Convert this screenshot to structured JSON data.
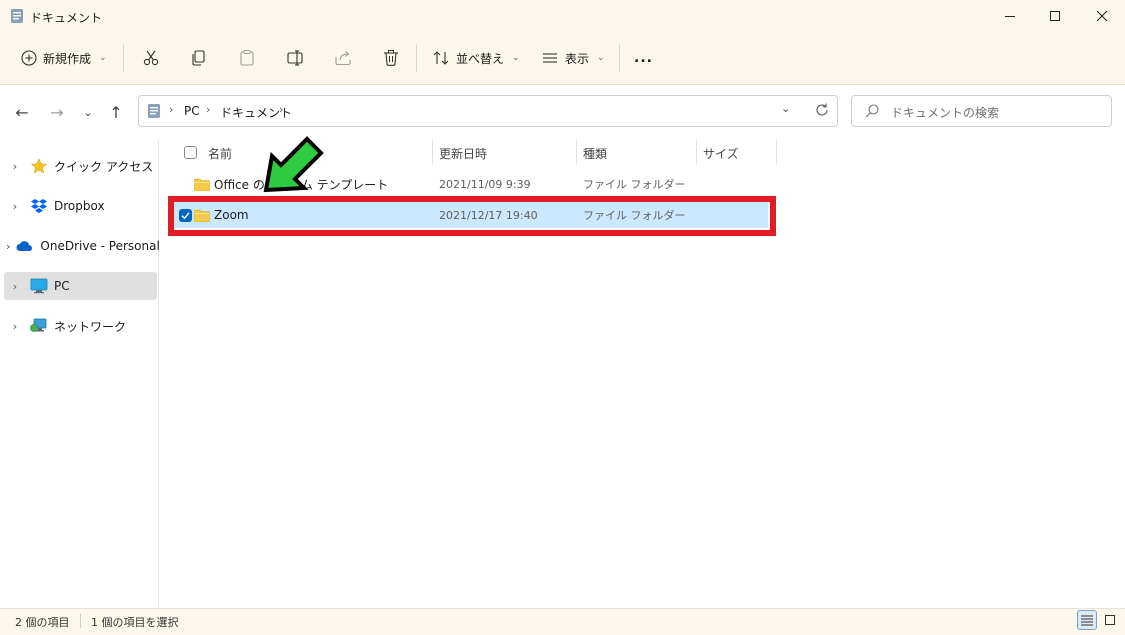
{
  "window": {
    "title": "ドキュメント",
    "icons": {
      "app": "document-icon",
      "minimize": "minimize-icon",
      "maximize": "maximize-icon",
      "close": "close-icon"
    }
  },
  "toolbar": {
    "new_label": "新規作成",
    "sort_label": "並べ替え",
    "view_label": "表示",
    "more_label": "..."
  },
  "address": {
    "crumbs": [
      "PC",
      "ドキュメント"
    ]
  },
  "search": {
    "placeholder": "ドキュメントの検索"
  },
  "sidebar": {
    "items": [
      {
        "label": "クイック アクセス",
        "icon": "star-icon"
      },
      {
        "label": "Dropbox",
        "icon": "dropbox-icon"
      },
      {
        "label": "OneDrive - Personal",
        "icon": "cloud-icon"
      },
      {
        "label": "PC",
        "icon": "monitor-icon",
        "selected": true
      },
      {
        "label": "ネットワーク",
        "icon": "network-icon"
      }
    ]
  },
  "columns": {
    "name": "名前",
    "modified": "更新日時",
    "type": "種類",
    "size": "サイズ"
  },
  "files": [
    {
      "name": "Office のカスタム テンプレート",
      "modified": "2021/11/09 9:39",
      "type": "ファイル フォルダー",
      "selected": false
    },
    {
      "name": "Zoom",
      "modified": "2021/12/17 19:40",
      "type": "ファイル フォルダー",
      "selected": true
    }
  ],
  "status": {
    "item_count": "2 個の項目",
    "selected_count": "1 個の項目を選択"
  },
  "colors": {
    "chrome_bg": "#fbf7ea",
    "selected_row": "#cce8ff",
    "highlight_border": "#e01e26",
    "arrow_fill": "#2ecc40",
    "folder": "#f6c94a",
    "accent": "#0067c0"
  }
}
